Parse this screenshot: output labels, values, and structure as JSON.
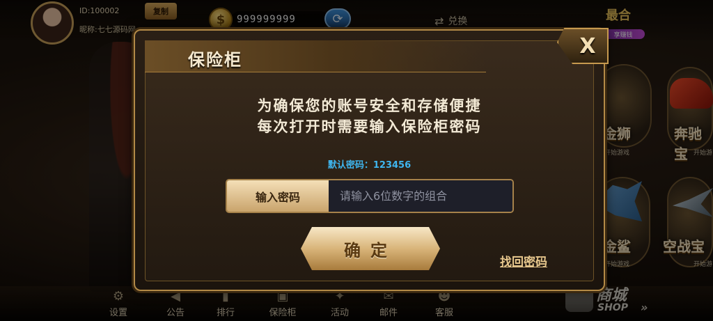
{
  "header": {
    "user_id": "ID:100002",
    "copy_label": "复制",
    "nickname": "昵称:七七源码网",
    "coin_amount": "999999999",
    "exchange_label": "兑换",
    "logo_text": "最合",
    "logo_sub": "享赚钱"
  },
  "games": [
    {
      "label": "奔驰宝",
      "sub": "开始游"
    },
    {
      "label": "金狮",
      "sub": "开始游戏"
    },
    {
      "label": "金鲨",
      "sub": "开始游戏"
    },
    {
      "label": "空战宝",
      "sub": "开始游"
    }
  ],
  "bottom_nav": {
    "items": [
      {
        "label": "设置",
        "icon": "gear-icon"
      },
      {
        "label": "公告",
        "icon": "megaphone-icon"
      },
      {
        "label": "排行",
        "icon": "bar-chart-icon"
      },
      {
        "label": "保险柜",
        "icon": "safe-icon"
      },
      {
        "label": "活动",
        "icon": "gift-icon"
      },
      {
        "label": "邮件",
        "icon": "mail-icon"
      },
      {
        "label": "客服",
        "icon": "headset-icon"
      }
    ],
    "shop_cn": "商城",
    "shop_en": "SHOP"
  },
  "modal": {
    "title": "保险柜",
    "close_label": "X",
    "notice_line1": "为确保您的账号安全和存储便捷",
    "notice_line2": "每次打开时需要输入保险柜密码",
    "default_password": "默认密码：123456",
    "input_label": "输入密码",
    "input_placeholder": "请输入6位数字的组合",
    "input_value": "",
    "confirm_label": "确定",
    "recover_label": "找回密码"
  },
  "colors": {
    "accent_gold": "#c79a4f",
    "info_blue": "#3fb6ef",
    "input_bg": "#1e1f29"
  }
}
